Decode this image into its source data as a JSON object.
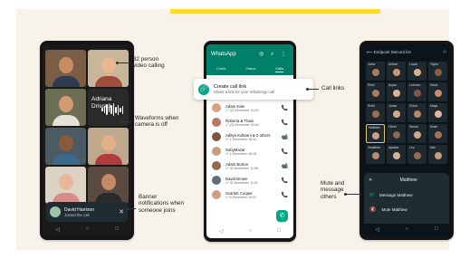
{
  "colors": {
    "background": "#f8f3ea",
    "accent": "#ffd92e",
    "whatsapp_green": "#008069",
    "call_green": "#00a884"
  },
  "annotations": {
    "video_calling": [
      "32 person",
      "video calling"
    ],
    "waveforms": [
      "Waveforms when",
      "camera is off"
    ],
    "banner": [
      "Banner",
      "notifications when",
      "someone joins"
    ],
    "call_links": "Call links",
    "mute": [
      "Mute and",
      "message",
      "others"
    ]
  },
  "phone1": {
    "participants": [
      {
        "name": "",
        "bg": "#7a5f46",
        "skin": "#c98d63",
        "shirt": "#2f3b52"
      },
      {
        "name": "",
        "bg": "#c9b59a",
        "skin": "#e7b892",
        "shirt": "#a14c3a"
      },
      {
        "name": "",
        "bg": "#6b6e53",
        "skin": "#d29a72",
        "shirt": "#e5e0d8"
      },
      {
        "name": "",
        "bg": "#4c5a64",
        "skin": "#8a5a3e",
        "shirt": "#3d6a8c"
      },
      {
        "name": "",
        "bg": "#bfa88c",
        "skin": "#e3b08a",
        "shirt": "#b23a3a"
      },
      {
        "name": "",
        "bg": "#ddd3c5",
        "skin": "#e6b99a",
        "shirt": "#d88b8b"
      },
      {
        "name": "",
        "bg": "#5a4a3f",
        "skin": "#c48a66",
        "shirt": "#2a2a2a"
      },
      {
        "name": "",
        "bg": "#6d7d8a",
        "skin": "#d9a988",
        "shirt": "#506a7d"
      }
    ],
    "waveform_name": [
      "Adriana",
      "Driscoll"
    ],
    "banner_name": "David Harrison",
    "banner_status": "Joined the call",
    "close_glyph": "✕",
    "nav": [
      "◁",
      "○",
      "□"
    ]
  },
  "phone2": {
    "app_title": "WhatsApp",
    "header_icons": "◎ ⌕ ⋮",
    "tabs": [
      "Chats",
      "Status",
      "Calls"
    ],
    "create_link_title": "Create call link",
    "create_link_sub": "Share a link for your WhatsApp call",
    "link_icon": "🔗",
    "calls": [
      {
        "name": "Adam Kale",
        "time": "☍ (2) December 10:32",
        "icon": "📞",
        "color": "#d8a27c"
      },
      {
        "name": "Roberta & Thais",
        "time": "☍ (3) December 09:44",
        "icon": "📞",
        "color": "#b7776b"
      },
      {
        "name": "Aditya Kulkarni & 2 others",
        "time": "☍ 1 December 18:44",
        "icon": "📹",
        "color": "#7a5647"
      },
      {
        "name": "SubyMazar",
        "time": "☍ 1 December 18:28",
        "icon": "📞",
        "color": "#c4a07c"
      },
      {
        "name": "Adam Burton",
        "time": "☍ 30 November 11:55",
        "icon": "📹",
        "color": "#8f6b52"
      },
      {
        "name": "David Brown",
        "time": "☍ 30 November 11:51",
        "icon": "📞",
        "color": "#5f6f7d"
      },
      {
        "name": "Scarlett Cooper",
        "time": "☍ 8 December 10:57",
        "icon": "📞",
        "color": "#d39b8b"
      }
    ],
    "fab": "✆",
    "nav": [
      "◁",
      "○",
      "□"
    ]
  },
  "phone3": {
    "header_title": "⟵ Endpoint Discord list",
    "header_icon": "⚇",
    "participants": [
      {
        "name": "Joela",
        "color": "#b07a5e"
      },
      {
        "name": "Anhad",
        "color": "#c99a78"
      },
      {
        "name": "Lucas",
        "color": "#d7b08c"
      },
      {
        "name": "Taylor",
        "color": "#8c5e48"
      },
      {
        "name": "Rishi",
        "color": "#a97c62"
      },
      {
        "name": "Aryan",
        "color": "#e0b294"
      },
      {
        "name": "Lorenzo",
        "color": "#7d5a46"
      },
      {
        "name": "Davis",
        "color": "#c08f6e"
      },
      {
        "name": "Rohit",
        "color": "#9c6d50"
      },
      {
        "name": "Jonas",
        "color": "#d6a98b"
      },
      {
        "name": "Chloe",
        "color": "#b68468"
      },
      {
        "name": "Maya",
        "color": "#e3b79b"
      },
      {
        "name": "Matthew",
        "color": "#caa07f"
      },
      {
        "name": "Oliver",
        "color": "#8e6650"
      },
      {
        "name": "Sasha",
        "color": "#d2a789"
      },
      {
        "name": "Noah",
        "color": "#a27356"
      },
      {
        "name": "Jonathan",
        "color": "#b98a6c"
      },
      {
        "name": "Ayesha",
        "color": "#dcae90"
      },
      {
        "name": "Leo",
        "color": "#946a53"
      },
      {
        "name": "Mia",
        "color": "#c89c80"
      }
    ],
    "sheet_title": "Matthew",
    "sheet_close": "✕",
    "message_label": "Message Matthew",
    "message_icon": "✉",
    "mute_label": "Mute Matthew",
    "mute_icon": "🔇",
    "nav": [
      "◁",
      "○",
      "□"
    ]
  }
}
